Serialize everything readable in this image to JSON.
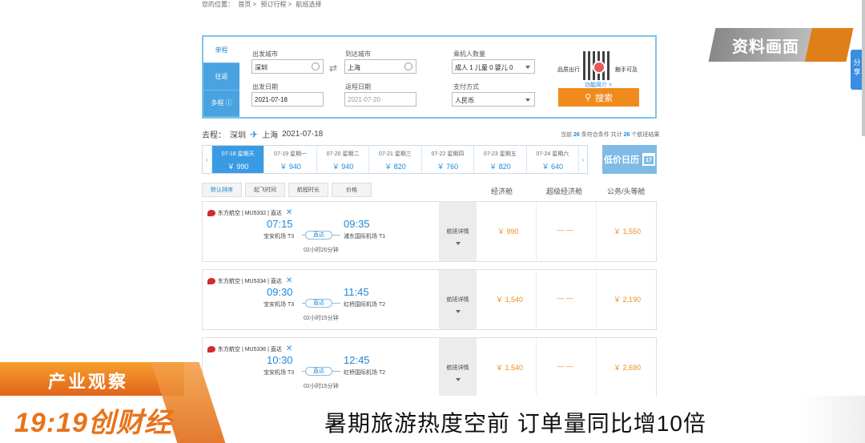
{
  "breadcrumb": [
    "您的位置：",
    "首页 >",
    "预订行程 >",
    "航班选择"
  ],
  "search": {
    "trip_tabs": [
      "单程",
      "往返",
      "多程 ⓘ"
    ],
    "dep_city_label": "出发城市",
    "dep_city": "深圳",
    "arr_city_label": "到达城市",
    "arr_city": "上海",
    "dep_date_label": "出发日期",
    "dep_date": "2021-07-18",
    "ret_date_label": "返程日期",
    "ret_date_placeholder": "2021-07-20",
    "passengers_label": "乘机人数量",
    "passengers": "成人 1  儿童 0  婴儿 0",
    "payment_label": "支付方式",
    "payment": "人民币",
    "promo_left": "品质出行",
    "promo_right": "触手可及",
    "promo_link": "功能简介 >",
    "search_button": "搜索"
  },
  "trip_summary": {
    "prefix": "去程：",
    "from": "深圳",
    "to": "上海",
    "date": "2021-07-18",
    "count_text_1": "当前",
    "count_match": "26",
    "count_text_2": "条符合条件 共计",
    "count_total": "26",
    "count_text_3": "个航班结果"
  },
  "date_bar": [
    {
      "date": "07-18 星期天",
      "price": "￥ 990",
      "active": true
    },
    {
      "date": "07-19 星期一",
      "price": "￥ 940"
    },
    {
      "date": "07-20 星期二",
      "price": "￥ 940"
    },
    {
      "date": "07-21 星期三",
      "price": "￥ 820"
    },
    {
      "date": "07-22 星期四",
      "price": "￥ 760"
    },
    {
      "date": "07-23 星期五",
      "price": "￥ 820"
    },
    {
      "date": "07-24 星期六",
      "price": "￥ 640"
    }
  ],
  "low_price_label": "低价日历",
  "calendar_day": "17",
  "sort": [
    "默认排序",
    "起飞时间",
    "航程时长",
    "价格"
  ],
  "cabins": [
    "经济舱",
    "超级经济舱",
    "公务/头等舱"
  ],
  "flights": [
    {
      "airline": "东方航空 | MU5332 | 直达",
      "dep": "07:15",
      "arr": "09:35",
      "dep_ap": "宝安机场 T3",
      "arr_ap": "浦东国际机场 T1",
      "tag": "直达",
      "duration": "02小时20分钟",
      "detail": "航班详情",
      "eco": "￥ 990",
      "super": "— —",
      "biz": "￥ 1,550"
    },
    {
      "airline": "东方航空 | MU5334 | 直达",
      "dep": "09:30",
      "arr": "11:45",
      "dep_ap": "宝安机场 T3",
      "arr_ap": "虹桥国际机场 T2",
      "tag": "直达",
      "duration": "02小时15分钟",
      "detail": "航班详情",
      "eco": "￥ 1,540",
      "super": "— —",
      "biz": "￥ 2,190"
    },
    {
      "airline": "东方航空 | MU5336 | 直达",
      "dep": "10:30",
      "arr": "12:45",
      "dep_ap": "宝安机场 T3",
      "arr_ap": "虹桥国际机场 T2",
      "tag": "直达",
      "duration": "02小时15分钟",
      "detail": "航班详情",
      "eco": "￥ 1,540",
      "super": "— —",
      "biz": "￥ 2,690"
    }
  ],
  "overlay": {
    "ziliao": "资料画面",
    "share": "分享",
    "tag": "产业观察",
    "logo": "19:19创财经",
    "headline": "暑期旅游热度空前  订单量同比增10倍"
  }
}
